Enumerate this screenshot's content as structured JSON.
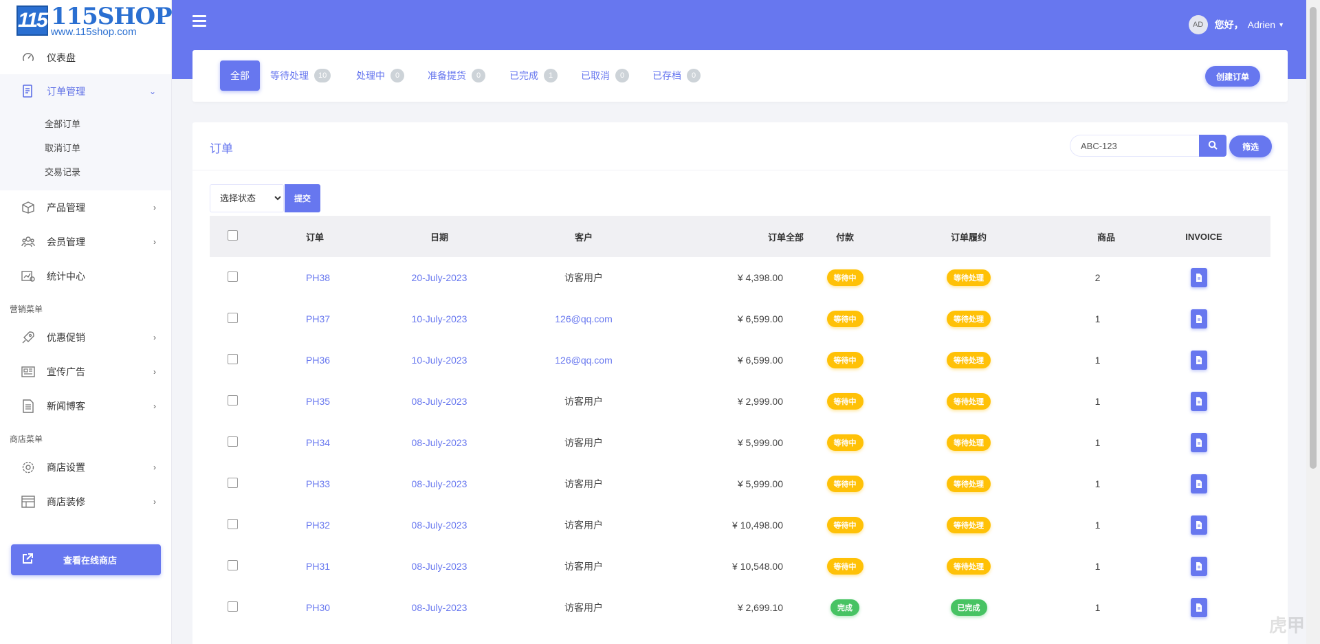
{
  "brand": {
    "mark": "115",
    "name": "115SHOP",
    "url": "www.115shop.com"
  },
  "sidebar": {
    "items": [
      {
        "label": "仪表盘",
        "icon": "dashboard-icon"
      },
      {
        "label": "订单管理",
        "icon": "orders-icon"
      },
      {
        "label": "产品管理",
        "icon": "box-icon"
      },
      {
        "label": "会员管理",
        "icon": "users-icon"
      },
      {
        "label": "统计中心",
        "icon": "chart-icon"
      }
    ],
    "subitems": [
      "全部订单",
      "取消订单",
      "交易记录"
    ],
    "section_marketing": "营销菜单",
    "marketing_items": [
      {
        "label": "优惠促销",
        "icon": "rocket-icon"
      },
      {
        "label": "宣传广告",
        "icon": "newspaper-icon"
      },
      {
        "label": "新闻博客",
        "icon": "document-icon"
      }
    ],
    "section_store": "商店菜单",
    "store_items": [
      {
        "label": "商店设置",
        "icon": "gear-icon"
      },
      {
        "label": "商店装修",
        "icon": "layout-icon"
      }
    ],
    "store_button": "查看在线商店"
  },
  "header": {
    "avatar": "AD",
    "greeting": "您好，",
    "user": "Adrien"
  },
  "tabs": [
    {
      "label": "全部",
      "count": ""
    },
    {
      "label": "等待处理",
      "count": "10"
    },
    {
      "label": "处理中",
      "count": "0"
    },
    {
      "label": "准备提货",
      "count": "0"
    },
    {
      "label": "已完成",
      "count": "1"
    },
    {
      "label": "已取消",
      "count": "0"
    },
    {
      "label": "已存档",
      "count": "0"
    }
  ],
  "create_order": "创建订单",
  "orders": {
    "title": "订单",
    "search_value": "ABC-123",
    "filter_label": "筛选",
    "status_select": "选择状态",
    "submit_label": "提交",
    "columns": [
      "订单",
      "日期",
      "客户",
      "订单全部",
      "付款",
      "订单履约",
      "商品",
      "INVOICE"
    ],
    "rows": [
      {
        "id": "PH38",
        "date": "20-July-2023",
        "customer": "访客用户",
        "total": "¥ 4,398.00",
        "payment": "等待中",
        "fulfillment": "等待处理",
        "items": "2",
        "status": "warn"
      },
      {
        "id": "PH37",
        "date": "10-July-2023",
        "customer": "126@qq.com",
        "total": "¥ 6,599.00",
        "payment": "等待中",
        "fulfillment": "等待处理",
        "items": "1",
        "status": "warn"
      },
      {
        "id": "PH36",
        "date": "10-July-2023",
        "customer": "126@qq.com",
        "total": "¥ 6,599.00",
        "payment": "等待中",
        "fulfillment": "等待处理",
        "items": "1",
        "status": "warn"
      },
      {
        "id": "PH35",
        "date": "08-July-2023",
        "customer": "访客用户",
        "total": "¥ 2,999.00",
        "payment": "等待中",
        "fulfillment": "等待处理",
        "items": "1",
        "status": "warn"
      },
      {
        "id": "PH34",
        "date": "08-July-2023",
        "customer": "访客用户",
        "total": "¥ 5,999.00",
        "payment": "等待中",
        "fulfillment": "等待处理",
        "items": "1",
        "status": "warn"
      },
      {
        "id": "PH33",
        "date": "08-July-2023",
        "customer": "访客用户",
        "total": "¥ 5,999.00",
        "payment": "等待中",
        "fulfillment": "等待处理",
        "items": "1",
        "status": "warn"
      },
      {
        "id": "PH32",
        "date": "08-July-2023",
        "customer": "访客用户",
        "total": "¥ 10,498.00",
        "payment": "等待中",
        "fulfillment": "等待处理",
        "items": "1",
        "status": "warn"
      },
      {
        "id": "PH31",
        "date": "08-July-2023",
        "customer": "访客用户",
        "total": "¥ 10,548.00",
        "payment": "等待中",
        "fulfillment": "等待处理",
        "items": "1",
        "status": "warn"
      },
      {
        "id": "PH30",
        "date": "08-July-2023",
        "customer": "访客用户",
        "total": "¥ 2,699.10",
        "payment": "完成",
        "fulfillment": "已完成",
        "items": "1",
        "status": "ok"
      }
    ]
  },
  "watermark": "虎甲",
  "colors": {
    "primary": "#6777ef",
    "warning": "#ffc107",
    "success": "#47c363"
  }
}
